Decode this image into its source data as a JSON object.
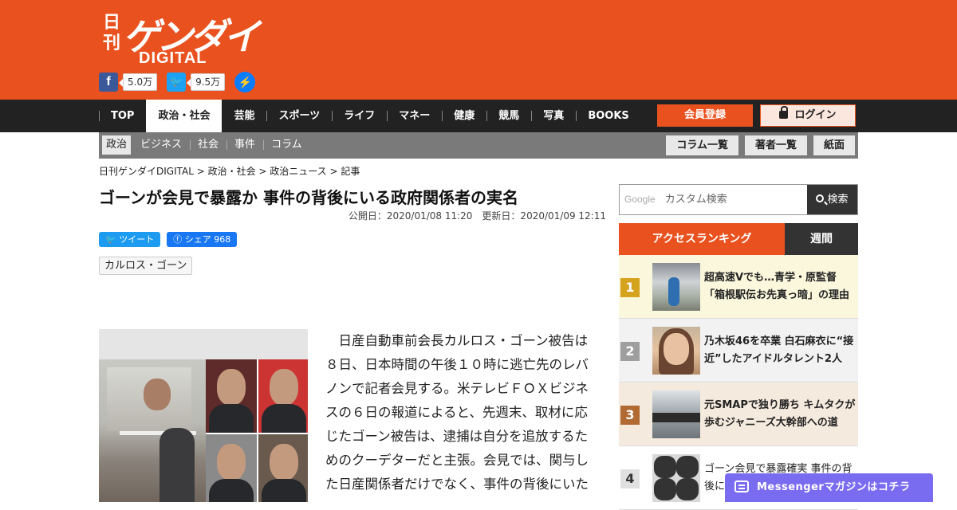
{
  "header": {
    "logo_small": "日刊",
    "logo_big": "ゲンダイ",
    "logo_sub": "DIGITAL",
    "fb_count": "5.0万",
    "tw_count": "9.5万"
  },
  "gnav": {
    "items": [
      "TOP",
      "政治・社会",
      "芸能",
      "スポーツ",
      "ライフ",
      "マネー",
      "健康",
      "競馬",
      "写真",
      "BOOKS"
    ],
    "register": "会員登録",
    "login": "ログイン"
  },
  "subnav": {
    "items": [
      "政治",
      "ビジネス",
      "社会",
      "事件",
      "コラム"
    ],
    "buttons": [
      "コラム一覧",
      "著者一覧",
      "紙面"
    ]
  },
  "breadcrumb": "日刊ゲンダイDIGITAL > 政治・社会 > 政治ニュース > 記事",
  "article": {
    "title": "ゴーンが会見で暴露か 事件の背後にいる政府関係者の実名",
    "dates": "公開日：2020/01/08 11:20　更新日：2020/01/09 12:11",
    "tweet": "ツイート",
    "fb_share": "シェア 968",
    "tag": "カルロス・ゴーン",
    "body": "日産自動車前会長カルロス・ゴーン被告は８日、日本時間の午後１０時に逃亡先のレバノンで記者会見する。米テレビＦＯＸビジネスの６日の報道によると、先週末、取材に応じたゴーン被告は、逮捕は自分を追放するためのクーデターだと主張。会見では、関与した日産関係者だけでなく、事件の背後にいた"
  },
  "search": {
    "google": "Google",
    "placeholder": "カスタム検索",
    "button": "検索"
  },
  "ranking": {
    "tab_access": "アクセスランキング",
    "tab_weekly": "週間",
    "items": [
      {
        "rank": "1",
        "title": "超高速Vでも…青学・原監督「箱根駅伝お先真っ暗」の理由"
      },
      {
        "rank": "2",
        "title": "乃木坂46を卒業 白石麻衣に“接近”したアイドルタレント2人"
      },
      {
        "rank": "3",
        "title": "元SMAPで独り勝ち キムタクが歩むジャニーズ大幹部への道"
      },
      {
        "rank": "4",
        "title": "ゴーン会見で暴露確実 事件の背後に"
      }
    ]
  },
  "messenger": "Messengerマガジンはコチラ",
  "colors": {
    "brand": "#e9521f",
    "nav": "#222222",
    "messenger": "#7a6cf0"
  }
}
